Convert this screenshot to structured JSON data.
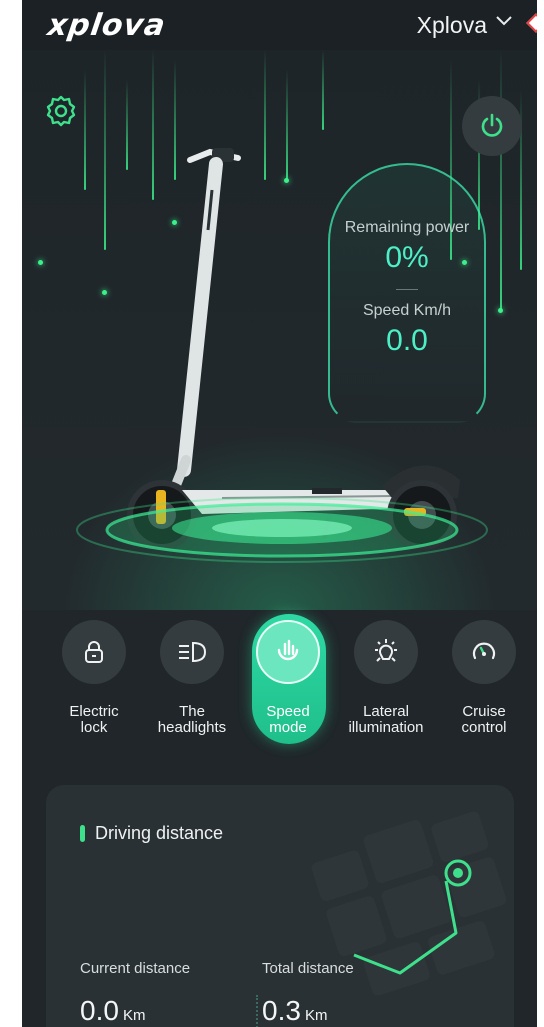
{
  "app": {
    "logo": "xplova",
    "device_name": "Xplova"
  },
  "status": {
    "power_label": "Remaining power",
    "power_value": "0%",
    "speed_label": "Speed Km/h",
    "speed_value": "0.0"
  },
  "modes": [
    {
      "line1": "Electric",
      "line2": "lock",
      "icon": "lock-icon",
      "active": false
    },
    {
      "line1": "The",
      "line2": "headlights",
      "icon": "headlight-icon",
      "active": false
    },
    {
      "line1": "Speed",
      "line2": "mode",
      "icon": "speed-mode-icon",
      "active": true
    },
    {
      "line1": "Lateral",
      "line2": "illumination",
      "icon": "sun-icon",
      "active": false
    },
    {
      "line1": "Cruise",
      "line2": "control",
      "icon": "gauge-icon",
      "active": false
    }
  ],
  "driving": {
    "title": "Driving distance",
    "current_label": "Current distance",
    "current_value": "0.0",
    "total_label": "Total distance",
    "total_value": "0.3",
    "unit": "Km"
  },
  "colors": {
    "accent": "#2ed9a4",
    "gauge_text": "#4cf0c6",
    "background": "#20262a"
  }
}
